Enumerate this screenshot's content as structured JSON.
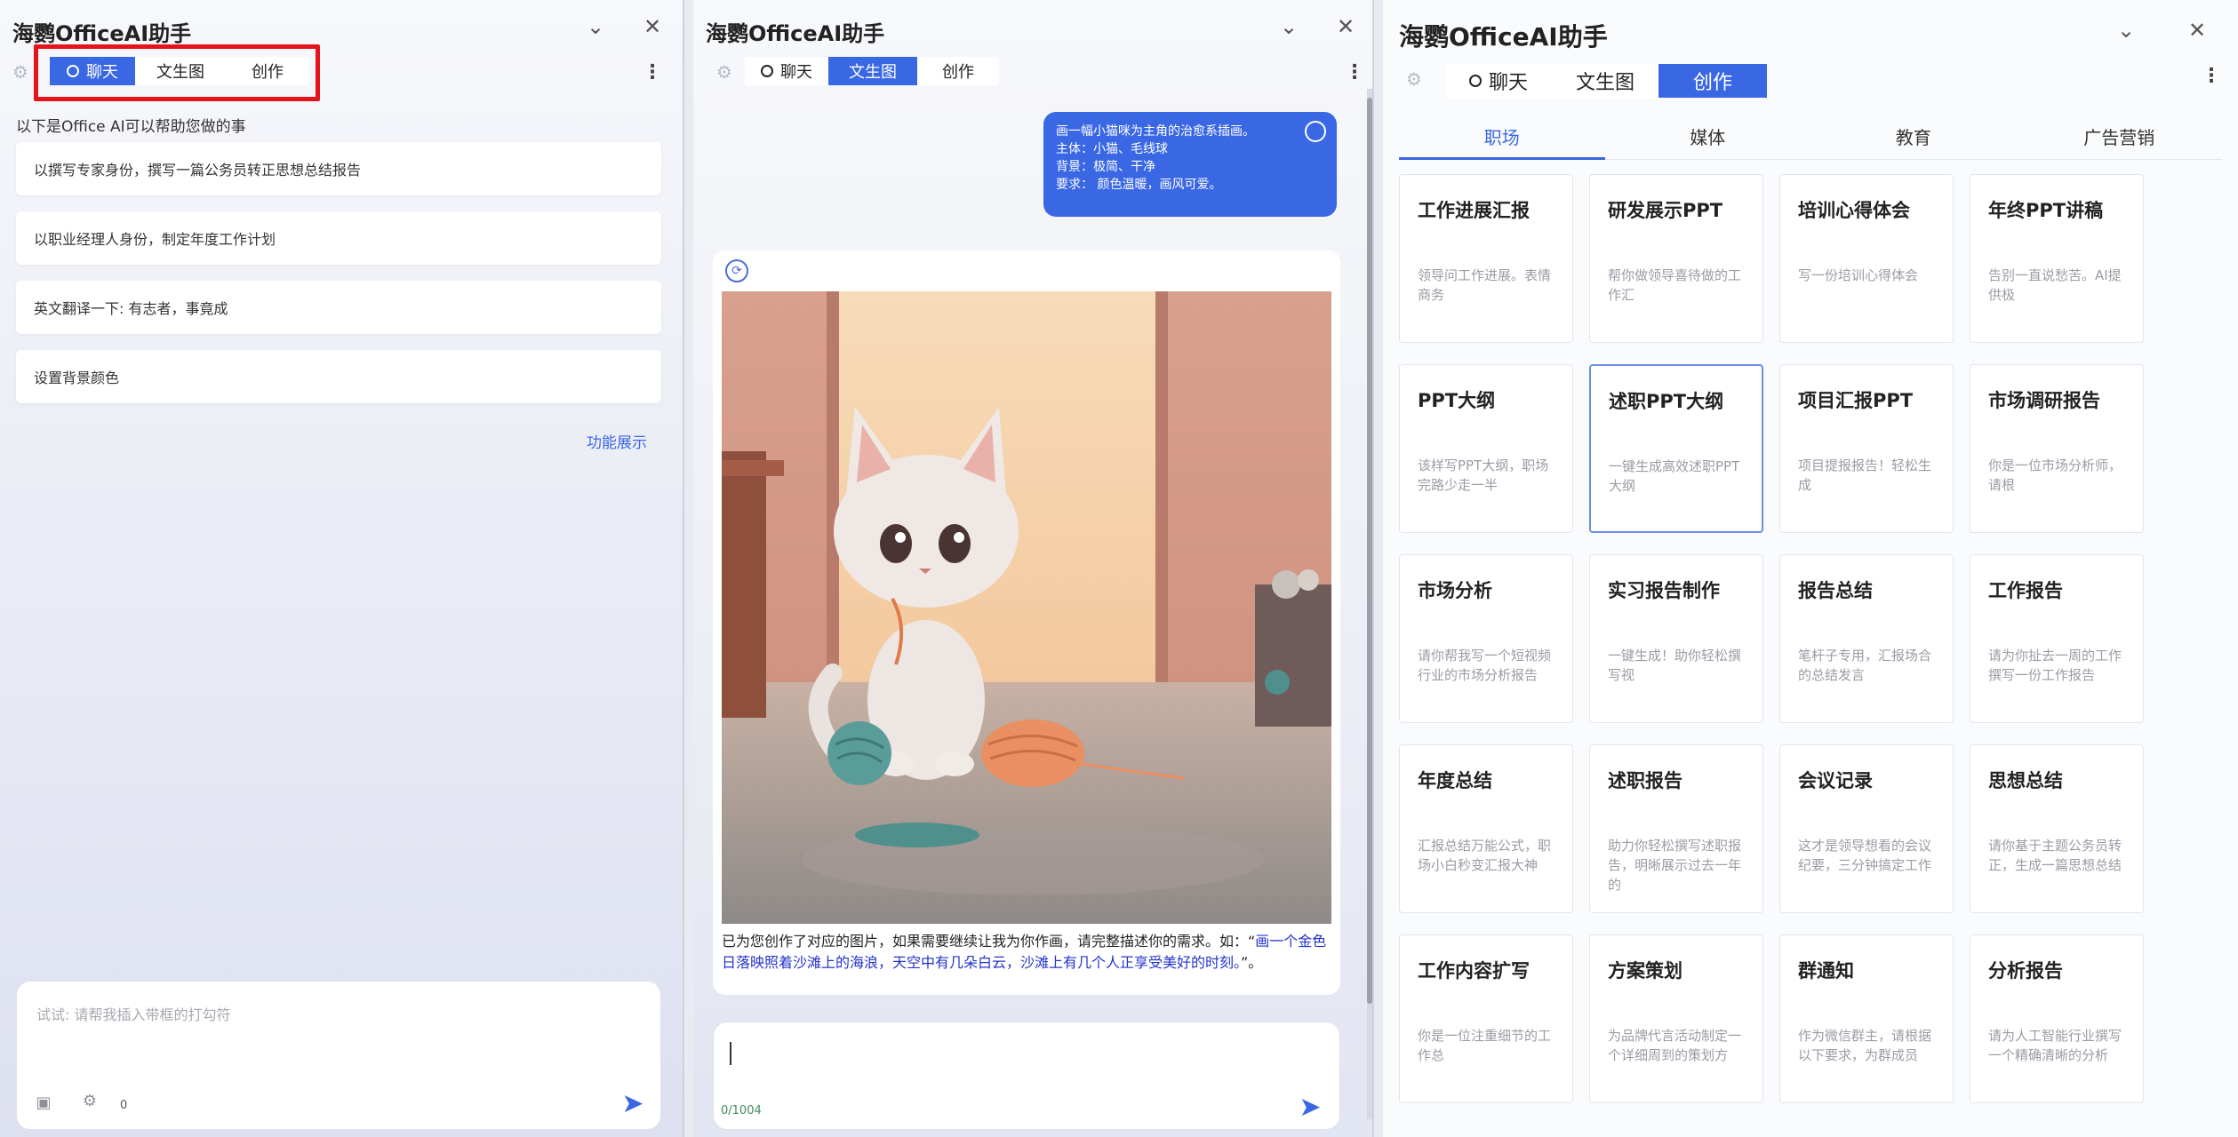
{
  "app": {
    "title": "海鹦OfficeAI助手"
  },
  "tabs": {
    "chat": "聊天",
    "text2img": "文生图",
    "create": "创作"
  },
  "panel1": {
    "intro": "以下是Office AI可以帮助您做的事",
    "suggestions": [
      "以撰写专家身份，撰写一篇公务员转正思想总结报告",
      "以职业经理人身份，制定年度工作计划",
      "英文翻译一下: 有志者，事竟成",
      "设置背景颜色"
    ],
    "feature_link": "功能展示",
    "input_placeholder": "试试: 请帮我插入带框的打勾符",
    "char_count": "0"
  },
  "panel2": {
    "prompt_lines": [
      "画一幅小猫咪为主角的治愈系插画。",
      "主体：小猫、毛线球",
      "背景：极简、干净",
      "要求： 颜色温暖，画风可爱。"
    ],
    "response_plain": "已为您创作了对应的图片，如果需要继续让我为你作画，请完整描述你的需求。如：“",
    "response_example": "画一个金色日落映照着沙滩上的海浪，天空中有几朵白云，沙滩上有几个人正享受美好的时刻。",
    "response_end": "”。",
    "input_value": "",
    "char_counter": "0/1004"
  },
  "panel3": {
    "categories": [
      "职场",
      "媒体",
      "教育",
      "广告营销"
    ],
    "active_category": "职场",
    "cards": [
      {
        "title": "工作进展汇报",
        "desc": "领导问工作进展。表情商务"
      },
      {
        "title": "研发展示PPT",
        "desc": "帮你做领导喜待做的工作汇"
      },
      {
        "title": "培训心得体会",
        "desc": "写一份培训心得体会"
      },
      {
        "title": "年终PPT讲稿",
        "desc": "告别一直说愁苦。AI提供极"
      },
      {
        "title": "PPT大纲",
        "desc": "该样写PPT大纲，职场完路少走一半"
      },
      {
        "title": "述职PPT大纲",
        "desc": "一键生成高效述职PPT大纲"
      },
      {
        "title": "项目汇报PPT",
        "desc": "项目提报报告！轻松生成"
      },
      {
        "title": "市场调研报告",
        "desc": "你是一位市场分析师，请根"
      },
      {
        "title": "市场分析",
        "desc": "请你帮我写一个短视频行业的市场分析报告"
      },
      {
        "title": "实习报告制作",
        "desc": "一键生成！助你轻松撰写视"
      },
      {
        "title": "报告总结",
        "desc": "笔杆子专用，汇报场合的总结发言"
      },
      {
        "title": "工作报告",
        "desc": "请为你扯去一周的工作撰写一份工作报告"
      },
      {
        "title": "年度总结",
        "desc": "汇报总结万能公式，职场小白秒变汇报大神"
      },
      {
        "title": "述职报告",
        "desc": "助力你轻松撰写述职报告，明晰展示过去一年的"
      },
      {
        "title": "会议记录",
        "desc": "这才是领导想看的会议纪要，三分钟搞定工作"
      },
      {
        "title": "思想总结",
        "desc": "请你基于主题公务员转正，生成一篇思想总结"
      },
      {
        "title": "工作内容扩写",
        "desc": "你是一位注重细节的工作总"
      },
      {
        "title": "方案策划",
        "desc": "为品牌代言活动制定一个详细周到的策划方"
      },
      {
        "title": "群通知",
        "desc": "作为微信群主，请根据以下要求，为群成员"
      },
      {
        "title": "分析报告",
        "desc": "请为人工智能行业撰写一个精确清晰的分析"
      }
    ],
    "selected_card": "述职PPT大纲"
  },
  "colors": {
    "accent": "#3a67e3",
    "highlight_box": "#e4141a"
  }
}
